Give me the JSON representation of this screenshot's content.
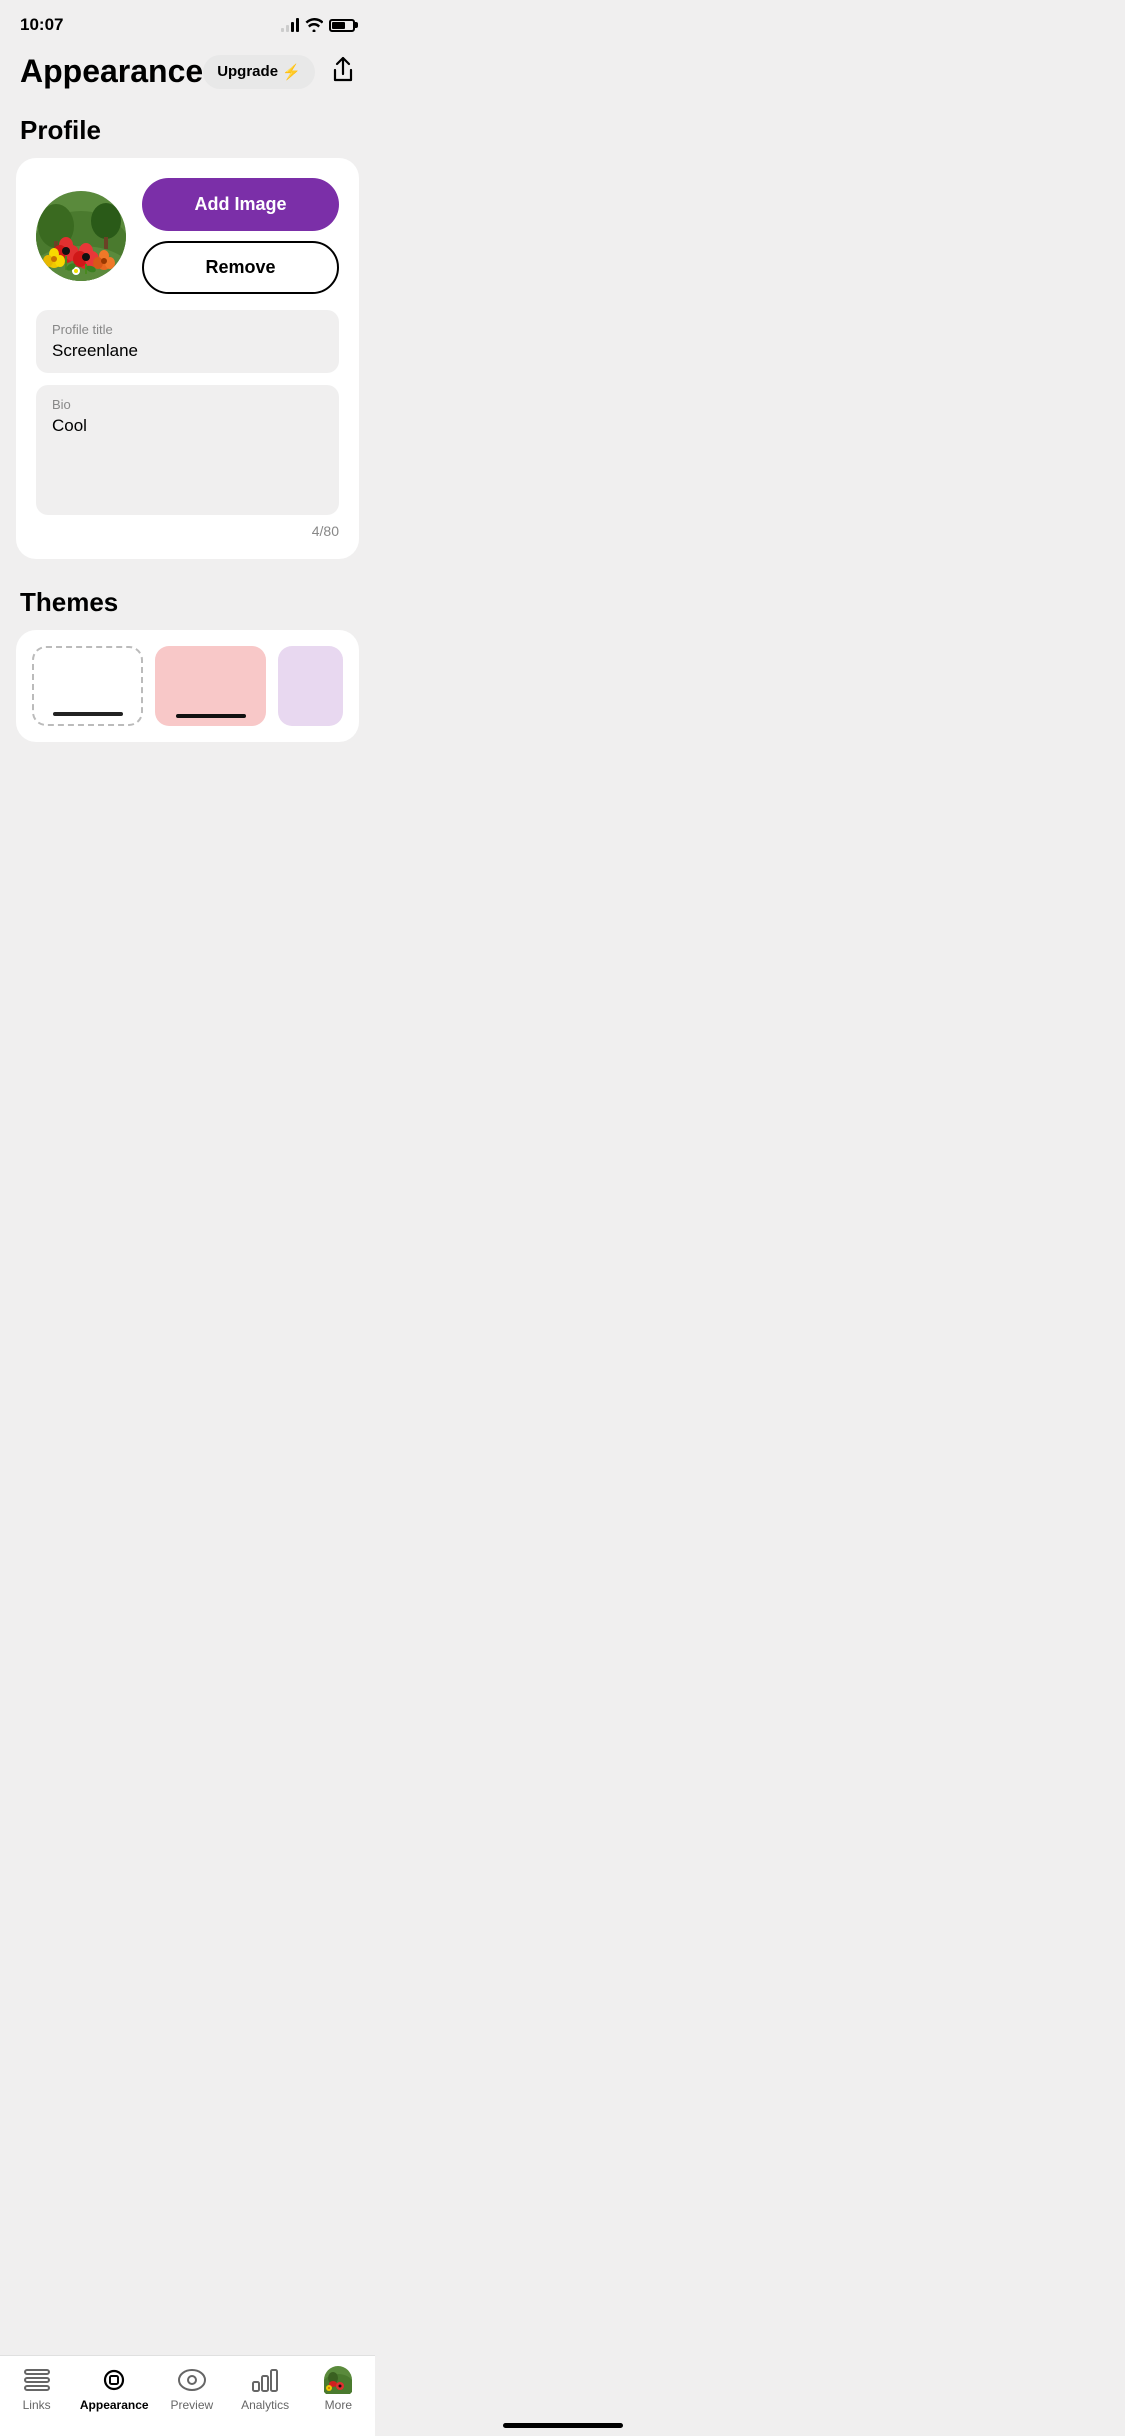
{
  "status": {
    "time": "10:07"
  },
  "header": {
    "title": "Appearance",
    "upgrade_label": "Upgrade",
    "upgrade_bolt": "⚡"
  },
  "profile_section": {
    "label": "Profile",
    "add_image_label": "Add Image",
    "remove_label": "Remove",
    "profile_title_label": "Profile title",
    "profile_title_value": "Screenlane",
    "bio_label": "Bio",
    "bio_value": "Cool",
    "bio_counter": "4/80"
  },
  "themes_section": {
    "label": "Themes"
  },
  "bottom_nav": {
    "links_label": "Links",
    "appearance_label": "Appearance",
    "preview_label": "Preview",
    "analytics_label": "Analytics",
    "more_label": "More"
  }
}
